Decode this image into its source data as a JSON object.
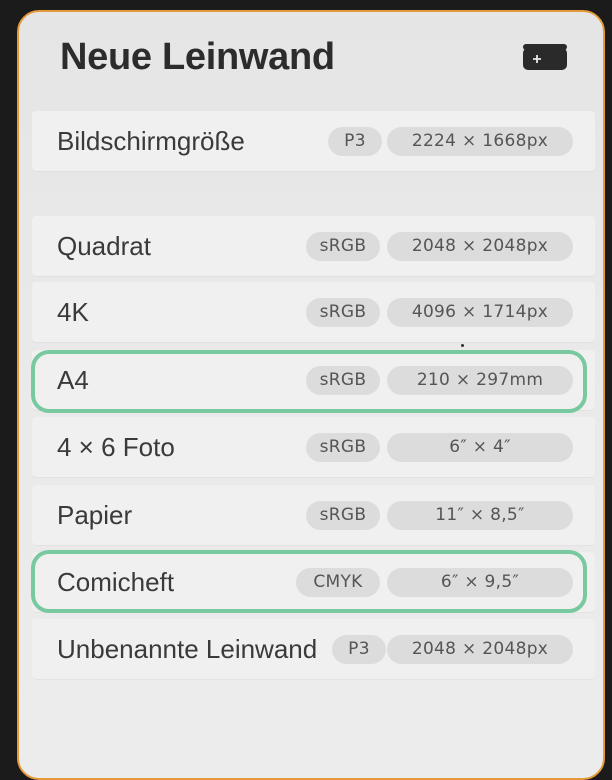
{
  "header": {
    "title": "Neue Leinwand"
  },
  "presets": [
    {
      "name": "Bildschirmgröße",
      "colorspace": "P3",
      "size": "2224 × 1668px"
    },
    {
      "name": "Quadrat",
      "colorspace": "sRGB",
      "size": "2048 × 2048px"
    },
    {
      "name": "4K",
      "colorspace": "sRGB",
      "size": "4096 × 1714px"
    },
    {
      "name": "A4",
      "colorspace": "sRGB",
      "size": "210 × 297mm"
    },
    {
      "name": "4 × 6 Foto",
      "colorspace": "sRGB",
      "size": "6″ × 4″"
    },
    {
      "name": "Papier",
      "colorspace": "sRGB",
      "size": "11″ × 8,5″"
    },
    {
      "name": "Comicheft",
      "colorspace": "CMYK",
      "size": "6″ × 9,5″"
    },
    {
      "name": "Unbenannte Leinwand",
      "colorspace": "P3",
      "size": "2048 × 2048px"
    }
  ],
  "colors": {
    "panel_border": "#e49a3a",
    "highlight": "#79c9a0"
  },
  "icons": {
    "add_canvas": "add-canvas-icon"
  }
}
